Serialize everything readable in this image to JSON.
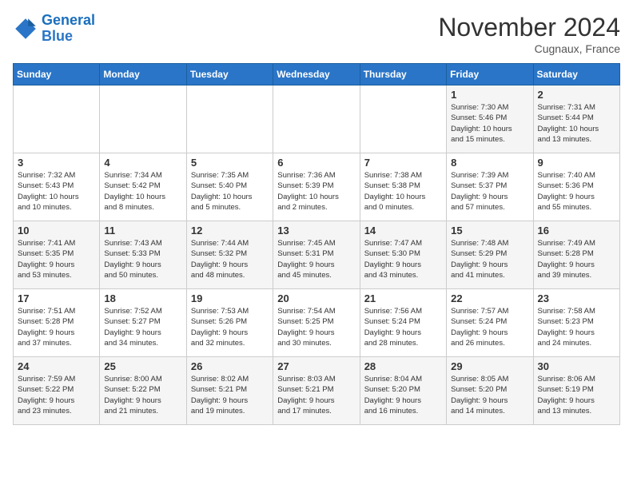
{
  "logo": {
    "line1": "General",
    "line2": "Blue"
  },
  "title": "November 2024",
  "location": "Cugnaux, France",
  "days_of_week": [
    "Sunday",
    "Monday",
    "Tuesday",
    "Wednesday",
    "Thursday",
    "Friday",
    "Saturday"
  ],
  "weeks": [
    [
      {
        "day": "",
        "info": ""
      },
      {
        "day": "",
        "info": ""
      },
      {
        "day": "",
        "info": ""
      },
      {
        "day": "",
        "info": ""
      },
      {
        "day": "",
        "info": ""
      },
      {
        "day": "1",
        "info": "Sunrise: 7:30 AM\nSunset: 5:46 PM\nDaylight: 10 hours\nand 15 minutes."
      },
      {
        "day": "2",
        "info": "Sunrise: 7:31 AM\nSunset: 5:44 PM\nDaylight: 10 hours\nand 13 minutes."
      }
    ],
    [
      {
        "day": "3",
        "info": "Sunrise: 7:32 AM\nSunset: 5:43 PM\nDaylight: 10 hours\nand 10 minutes."
      },
      {
        "day": "4",
        "info": "Sunrise: 7:34 AM\nSunset: 5:42 PM\nDaylight: 10 hours\nand 8 minutes."
      },
      {
        "day": "5",
        "info": "Sunrise: 7:35 AM\nSunset: 5:40 PM\nDaylight: 10 hours\nand 5 minutes."
      },
      {
        "day": "6",
        "info": "Sunrise: 7:36 AM\nSunset: 5:39 PM\nDaylight: 10 hours\nand 2 minutes."
      },
      {
        "day": "7",
        "info": "Sunrise: 7:38 AM\nSunset: 5:38 PM\nDaylight: 10 hours\nand 0 minutes."
      },
      {
        "day": "8",
        "info": "Sunrise: 7:39 AM\nSunset: 5:37 PM\nDaylight: 9 hours\nand 57 minutes."
      },
      {
        "day": "9",
        "info": "Sunrise: 7:40 AM\nSunset: 5:36 PM\nDaylight: 9 hours\nand 55 minutes."
      }
    ],
    [
      {
        "day": "10",
        "info": "Sunrise: 7:41 AM\nSunset: 5:35 PM\nDaylight: 9 hours\nand 53 minutes."
      },
      {
        "day": "11",
        "info": "Sunrise: 7:43 AM\nSunset: 5:33 PM\nDaylight: 9 hours\nand 50 minutes."
      },
      {
        "day": "12",
        "info": "Sunrise: 7:44 AM\nSunset: 5:32 PM\nDaylight: 9 hours\nand 48 minutes."
      },
      {
        "day": "13",
        "info": "Sunrise: 7:45 AM\nSunset: 5:31 PM\nDaylight: 9 hours\nand 45 minutes."
      },
      {
        "day": "14",
        "info": "Sunrise: 7:47 AM\nSunset: 5:30 PM\nDaylight: 9 hours\nand 43 minutes."
      },
      {
        "day": "15",
        "info": "Sunrise: 7:48 AM\nSunset: 5:29 PM\nDaylight: 9 hours\nand 41 minutes."
      },
      {
        "day": "16",
        "info": "Sunrise: 7:49 AM\nSunset: 5:28 PM\nDaylight: 9 hours\nand 39 minutes."
      }
    ],
    [
      {
        "day": "17",
        "info": "Sunrise: 7:51 AM\nSunset: 5:28 PM\nDaylight: 9 hours\nand 37 minutes."
      },
      {
        "day": "18",
        "info": "Sunrise: 7:52 AM\nSunset: 5:27 PM\nDaylight: 9 hours\nand 34 minutes."
      },
      {
        "day": "19",
        "info": "Sunrise: 7:53 AM\nSunset: 5:26 PM\nDaylight: 9 hours\nand 32 minutes."
      },
      {
        "day": "20",
        "info": "Sunrise: 7:54 AM\nSunset: 5:25 PM\nDaylight: 9 hours\nand 30 minutes."
      },
      {
        "day": "21",
        "info": "Sunrise: 7:56 AM\nSunset: 5:24 PM\nDaylight: 9 hours\nand 28 minutes."
      },
      {
        "day": "22",
        "info": "Sunrise: 7:57 AM\nSunset: 5:24 PM\nDaylight: 9 hours\nand 26 minutes."
      },
      {
        "day": "23",
        "info": "Sunrise: 7:58 AM\nSunset: 5:23 PM\nDaylight: 9 hours\nand 24 minutes."
      }
    ],
    [
      {
        "day": "24",
        "info": "Sunrise: 7:59 AM\nSunset: 5:22 PM\nDaylight: 9 hours\nand 23 minutes."
      },
      {
        "day": "25",
        "info": "Sunrise: 8:00 AM\nSunset: 5:22 PM\nDaylight: 9 hours\nand 21 minutes."
      },
      {
        "day": "26",
        "info": "Sunrise: 8:02 AM\nSunset: 5:21 PM\nDaylight: 9 hours\nand 19 minutes."
      },
      {
        "day": "27",
        "info": "Sunrise: 8:03 AM\nSunset: 5:21 PM\nDaylight: 9 hours\nand 17 minutes."
      },
      {
        "day": "28",
        "info": "Sunrise: 8:04 AM\nSunset: 5:20 PM\nDaylight: 9 hours\nand 16 minutes."
      },
      {
        "day": "29",
        "info": "Sunrise: 8:05 AM\nSunset: 5:20 PM\nDaylight: 9 hours\nand 14 minutes."
      },
      {
        "day": "30",
        "info": "Sunrise: 8:06 AM\nSunset: 5:19 PM\nDaylight: 9 hours\nand 13 minutes."
      }
    ]
  ]
}
